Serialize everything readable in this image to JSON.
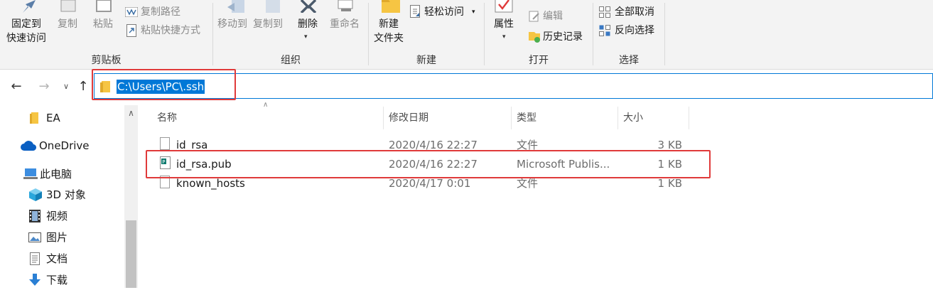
{
  "ribbon": {
    "clipboard": {
      "label": "剪贴板",
      "pin_line1": "固定到",
      "pin_line2": "快速访问",
      "copy": "复制",
      "paste": "粘贴",
      "copy_path": "复制路径",
      "paste_shortcut": "粘贴快捷方式"
    },
    "organize": {
      "label": "组织",
      "move_to": "移动到",
      "copy_to": "复制到",
      "delete": "删除",
      "rename": "重命名"
    },
    "new": {
      "label": "新建",
      "new_folder_line1": "新建",
      "new_folder_line2": "文件夹",
      "easy_access": "轻松访问"
    },
    "open": {
      "label": "打开",
      "properties": "属性",
      "edit": "编辑",
      "history": "历史记录"
    },
    "select": {
      "label": "选择",
      "select_none": "全部取消",
      "invert_selection": "反向选择"
    }
  },
  "address": {
    "path": "C:\\Users\\PC\\.ssh"
  },
  "nav": {
    "items": [
      {
        "label": "EA",
        "icon": "folder-icon"
      },
      {
        "label": "OneDrive",
        "icon": "cloud-icon"
      },
      {
        "label": "此电脑",
        "icon": "computer-icon"
      },
      {
        "label": "3D 对象",
        "icon": "cube-icon"
      },
      {
        "label": "视频",
        "icon": "video-icon"
      },
      {
        "label": "图片",
        "icon": "picture-icon"
      },
      {
        "label": "文档",
        "icon": "document-icon"
      },
      {
        "label": "下载",
        "icon": "download-icon"
      }
    ]
  },
  "columns": {
    "name": "名称",
    "date": "修改日期",
    "type": "类型",
    "size": "大小"
  },
  "files": [
    {
      "name": "id_rsa",
      "date": "2020/4/16 22:27",
      "type": "文件",
      "size": "3 KB"
    },
    {
      "name": "id_rsa.pub",
      "date": "2020/4/16 22:27",
      "type": "Microsoft Publis...",
      "size": "1 KB"
    },
    {
      "name": "known_hosts",
      "date": "2020/4/17 0:01",
      "type": "文件",
      "size": "1 KB"
    }
  ],
  "colors": {
    "accent": "#0078d7",
    "highlight_box": "#e03a3a",
    "ribbon_bg": "#f3f3f3"
  }
}
